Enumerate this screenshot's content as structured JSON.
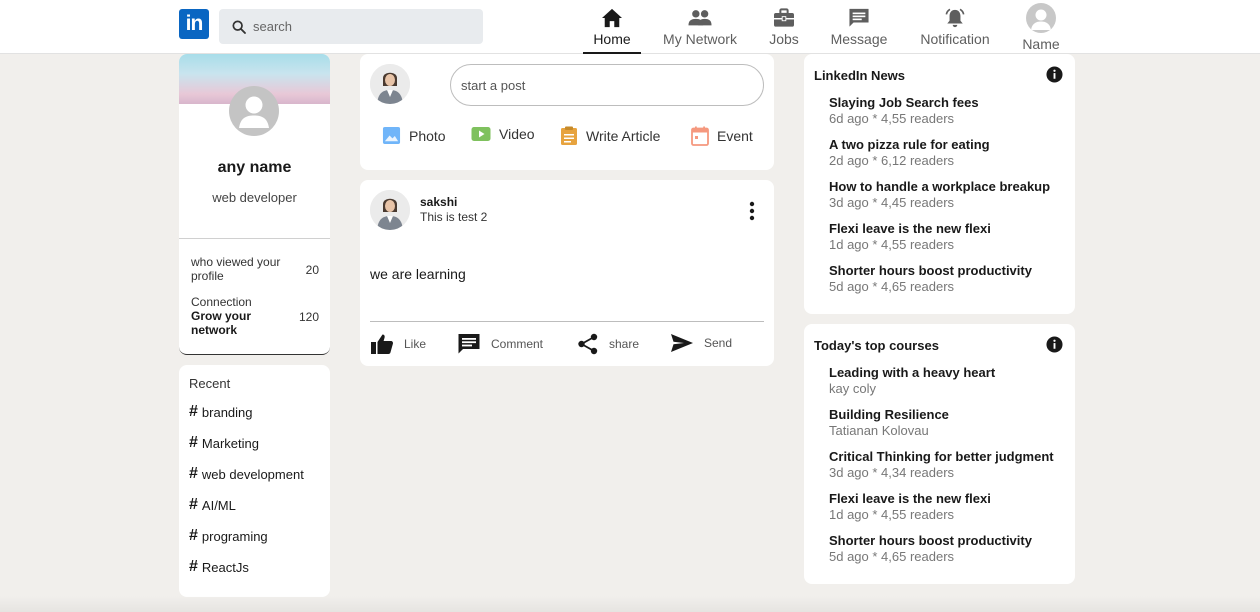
{
  "header": {
    "logo_text": "in",
    "search_placeholder": "search",
    "nav": [
      {
        "label": "Home",
        "icon": "home-icon",
        "active": true
      },
      {
        "label": "My Network",
        "icon": "network-icon",
        "active": false
      },
      {
        "label": "Jobs",
        "icon": "briefcase-icon",
        "active": false
      },
      {
        "label": "Message",
        "icon": "message-icon",
        "active": false
      },
      {
        "label": "Notification",
        "icon": "bell-icon",
        "active": false
      },
      {
        "label": "Name",
        "icon": "user-avatar-icon",
        "active": false
      }
    ]
  },
  "profile": {
    "name": "any name",
    "title": "web developer",
    "stat1_label": "who viewed your profile",
    "stat1_value": "20",
    "stat2_label": "Connection",
    "stat2_sub": "Grow your network",
    "stat2_value": "120"
  },
  "recent": {
    "title": "Recent",
    "items": [
      "branding",
      "Marketing",
      "web development",
      "AI/ML",
      "programing",
      "ReactJs"
    ]
  },
  "composer": {
    "placeholder": "start a post",
    "actions": [
      {
        "label": "Photo",
        "icon": "photo-icon",
        "color": "#70b5f9"
      },
      {
        "label": "Video",
        "icon": "video-icon",
        "color": "#7fc15e"
      },
      {
        "label": "Write Article",
        "icon": "article-icon",
        "color": "#e7a33e"
      },
      {
        "label": "Event",
        "icon": "calendar-icon",
        "color": "#f5987e"
      }
    ]
  },
  "post": {
    "author": "sakshi",
    "subtitle": "This is test 2",
    "text": "we are learning",
    "actions": [
      {
        "label": "Like",
        "icon": "thumbs-up-icon"
      },
      {
        "label": "Comment",
        "icon": "comment-icon"
      },
      {
        "label": "share",
        "icon": "share-icon"
      },
      {
        "label": "Send",
        "icon": "send-icon"
      }
    ]
  },
  "news": {
    "title": "LinkedIn News",
    "items": [
      {
        "title": "Slaying Job Search fees",
        "meta": "6d ago * 4,55 readers"
      },
      {
        "title": "A two pizza rule for eating",
        "meta": "2d ago * 6,12 readers"
      },
      {
        "title": "How to handle a workplace breakup",
        "meta": "3d ago * 4,45 readers"
      },
      {
        "title": "Flexi leave is the new flexi",
        "meta": "1d ago * 4,55 readers"
      },
      {
        "title": "Shorter hours boost productivity",
        "meta": "5d ago * 4,65 readers"
      }
    ]
  },
  "courses": {
    "title": "Today's top courses",
    "items": [
      {
        "title": "Leading with a heavy heart",
        "meta": "kay coly"
      },
      {
        "title": "Building Resilience",
        "meta": "Tatianan Kolovau"
      },
      {
        "title": "Critical Thinking for better judgment",
        "meta": "3d ago * 4,34 readers"
      },
      {
        "title": "Flexi leave is the new flexi",
        "meta": "1d ago * 4,55 readers"
      },
      {
        "title": "Shorter hours boost productivity",
        "meta": "5d ago * 4,65 readers"
      }
    ]
  },
  "colors": {
    "brand": "#0a66c2",
    "page_bg": "#f1efec"
  }
}
